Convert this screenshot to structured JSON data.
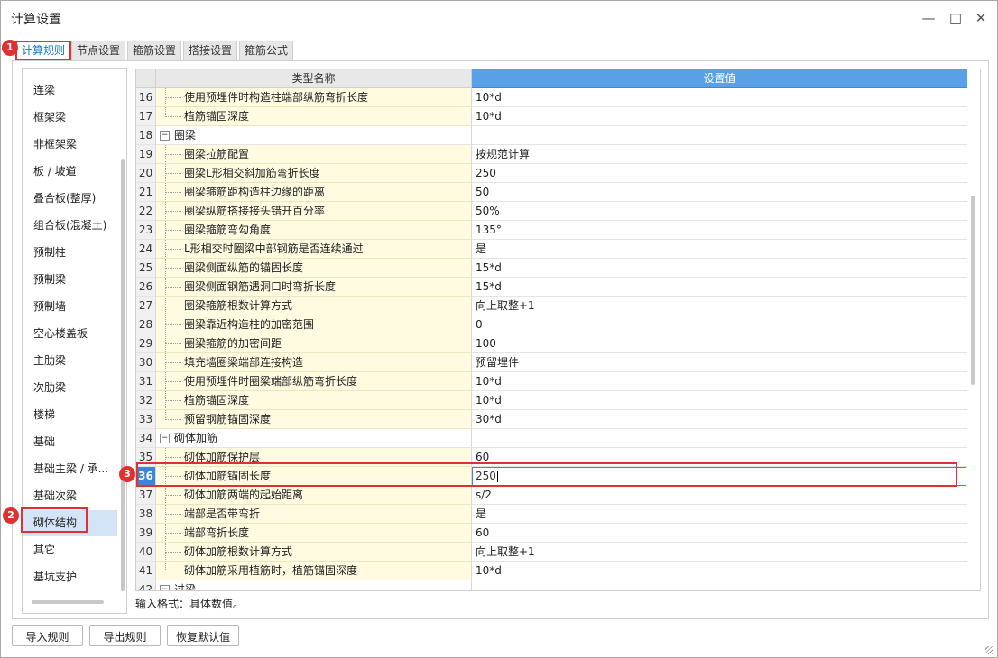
{
  "window": {
    "title": "计算设置",
    "controls": [
      "minimize-icon",
      "maximize-icon",
      "close-icon"
    ]
  },
  "tabs": [
    {
      "label": "计算规则",
      "active": true
    },
    {
      "label": "节点设置",
      "active": false
    },
    {
      "label": "箍筋设置",
      "active": false
    },
    {
      "label": "搭接设置",
      "active": false
    },
    {
      "label": "箍筋公式",
      "active": false
    }
  ],
  "sidebar": {
    "items": [
      {
        "label": "连梁"
      },
      {
        "label": "框架梁"
      },
      {
        "label": "非框架梁"
      },
      {
        "label": "板 / 坡道"
      },
      {
        "label": "叠合板(整厚)"
      },
      {
        "label": "组合板(混凝土)"
      },
      {
        "label": "预制柱"
      },
      {
        "label": "预制梁"
      },
      {
        "label": "预制墙"
      },
      {
        "label": "空心楼盖板"
      },
      {
        "label": "主肋梁"
      },
      {
        "label": "次肋梁"
      },
      {
        "label": "楼梯"
      },
      {
        "label": "基础"
      },
      {
        "label": "基础主梁 / 承..."
      },
      {
        "label": "基础次梁"
      },
      {
        "label": "砌体结构",
        "selected": true
      },
      {
        "label": "其它"
      },
      {
        "label": "基坑支护"
      }
    ]
  },
  "grid": {
    "columns": [
      "类型名称",
      "设置值"
    ],
    "rows": [
      {
        "no": "16",
        "name": "使用预埋件时构造柱端部纵筋弯折长度",
        "value": "10*d"
      },
      {
        "no": "17",
        "name": "植筋锚固深度",
        "value": "10*d"
      },
      {
        "no": "18",
        "name": "圈梁",
        "value": "",
        "category": true
      },
      {
        "no": "19",
        "name": "圈梁拉筋配置",
        "value": "按规范计算"
      },
      {
        "no": "20",
        "name": "圈梁L形相交斜加筋弯折长度",
        "value": "250"
      },
      {
        "no": "21",
        "name": "圈梁箍筋距构造柱边缘的距离",
        "value": "50"
      },
      {
        "no": "22",
        "name": "圈梁纵筋搭接接头错开百分率",
        "value": "50%"
      },
      {
        "no": "23",
        "name": "圈梁箍筋弯勾角度",
        "value": "135°"
      },
      {
        "no": "24",
        "name": "L形相交时圈梁中部钢筋是否连续通过",
        "value": "是"
      },
      {
        "no": "25",
        "name": "圈梁侧面纵筋的锚固长度",
        "value": "15*d"
      },
      {
        "no": "26",
        "name": "圈梁侧面钢筋遇洞口时弯折长度",
        "value": "15*d"
      },
      {
        "no": "27",
        "name": "圈梁箍筋根数计算方式",
        "value": "向上取整+1"
      },
      {
        "no": "28",
        "name": "圈梁靠近构造柱的加密范围",
        "value": "0"
      },
      {
        "no": "29",
        "name": "圈梁箍筋的加密间距",
        "value": "100"
      },
      {
        "no": "30",
        "name": "填充墙圈梁端部连接构造",
        "value": "预留埋件"
      },
      {
        "no": "31",
        "name": "使用预埋件时圈梁端部纵筋弯折长度",
        "value": "10*d"
      },
      {
        "no": "32",
        "name": "植筋锚固深度",
        "value": "10*d"
      },
      {
        "no": "33",
        "name": "预留钢筋锚固深度",
        "value": "30*d"
      },
      {
        "no": "34",
        "name": "砌体加筋",
        "value": "",
        "category": true
      },
      {
        "no": "35",
        "name": "砌体加筋保护层",
        "value": "60"
      },
      {
        "no": "36",
        "name": "砌体加筋锚固长度",
        "value": "250",
        "current": true
      },
      {
        "no": "37",
        "name": "砌体加筋两端的起始距离",
        "value": "s/2"
      },
      {
        "no": "38",
        "name": "端部是否带弯折",
        "value": "是"
      },
      {
        "no": "39",
        "name": "端部弯折长度",
        "value": "60"
      },
      {
        "no": "40",
        "name": "砌体加筋根数计算方式",
        "value": "向上取整+1"
      },
      {
        "no": "41",
        "name": "砌体加筋采用植筋时，植筋锚固深度",
        "value": "10*d"
      },
      {
        "no": "42",
        "name": "过梁",
        "value": "",
        "category": true
      }
    ]
  },
  "hint": "输入格式：具体数值。",
  "buttons": {
    "import": "导入规则",
    "export": "导出规则",
    "restore": "恢复默认值"
  },
  "annotations": [
    "1",
    "2",
    "3"
  ],
  "colors": {
    "accent": "#3b86d7",
    "highlight": "#e03030",
    "name_cell_bg": "#fffbe0",
    "selected_sidebar": "#d4e4f7"
  }
}
